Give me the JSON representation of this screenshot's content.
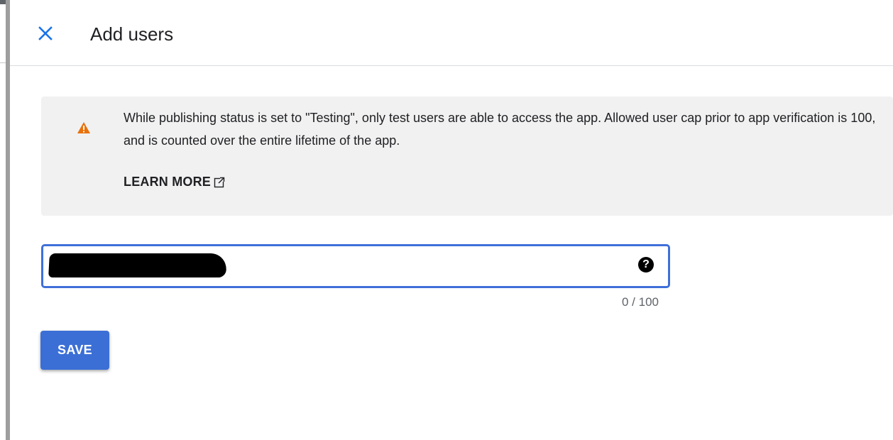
{
  "header": {
    "title": "Add users",
    "close_icon": "close-icon"
  },
  "notice": {
    "icon": "warning-icon",
    "text": "While publishing status is set to \"Testing\", only test users are able to access the app. Allowed user cap prior to app verification is 100, and is counted over the entire lifetime of the app.",
    "link_label": "LEARN MORE",
    "link_icon": "external-link-icon",
    "warning_color": "#e8710a"
  },
  "user_field": {
    "value": "",
    "help_icon": "help-icon",
    "counter": "0 / 100",
    "accent_color": "#3f6fd8"
  },
  "actions": {
    "save_label": "SAVE",
    "save_color": "#3b6fd6"
  }
}
